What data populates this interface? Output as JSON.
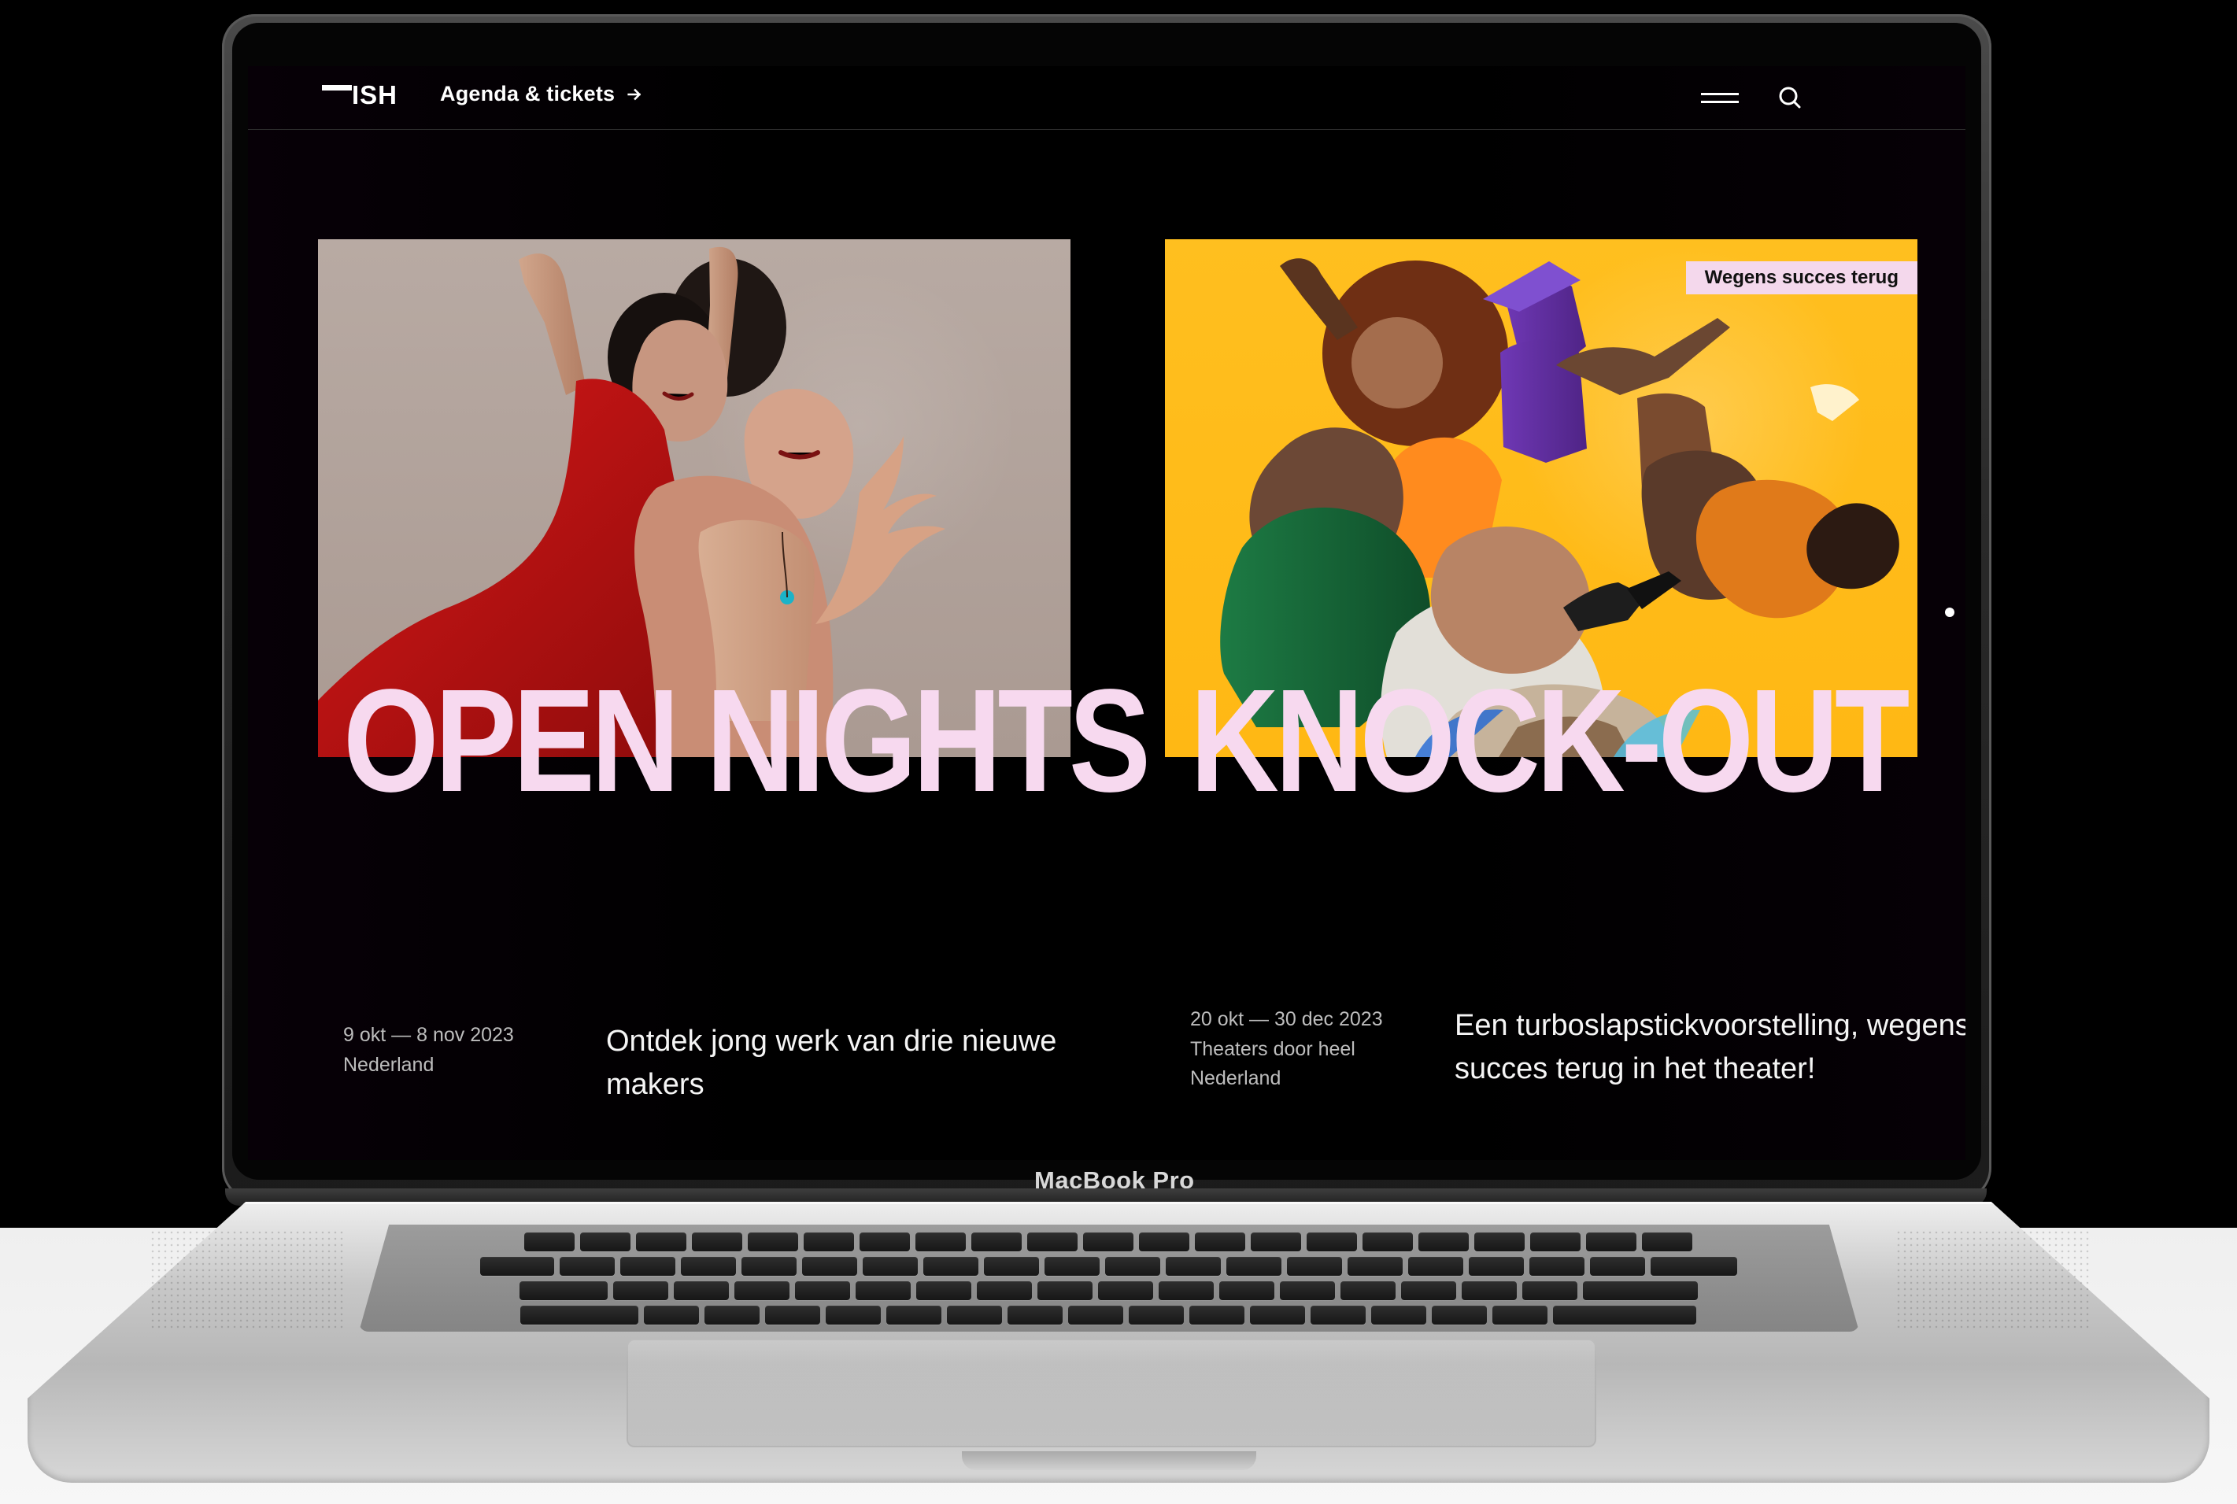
{
  "device": {
    "brand_label": "MacBook Pro"
  },
  "header": {
    "logo_text": "ISH",
    "nav_link": "Agenda & tickets"
  },
  "icons": {
    "arrow": "arrow-right-icon",
    "menu": "menu-icon",
    "search": "search-icon"
  },
  "cards": [
    {
      "title": "OPEN NIGHTS",
      "date": "9 okt — 8 nov 2023",
      "location": "Nederland",
      "description": "Ontdek jong werk van drie nieuwe makers"
    },
    {
      "badge": "Wegens succes terug",
      "title": "KNOCK-OUT",
      "date": "20 okt — 30 dec 2023",
      "location": "Theaters door heel Nederland",
      "description": "Een turboslapstickvoorstelling, wegens succes terug in het theater!"
    }
  ],
  "colors": {
    "title_pink": "#f7d9ef",
    "badge_pink": "#f4d8ec",
    "right_image_yellow": "#ffb814",
    "left_image_beige": "#aa9a92"
  }
}
